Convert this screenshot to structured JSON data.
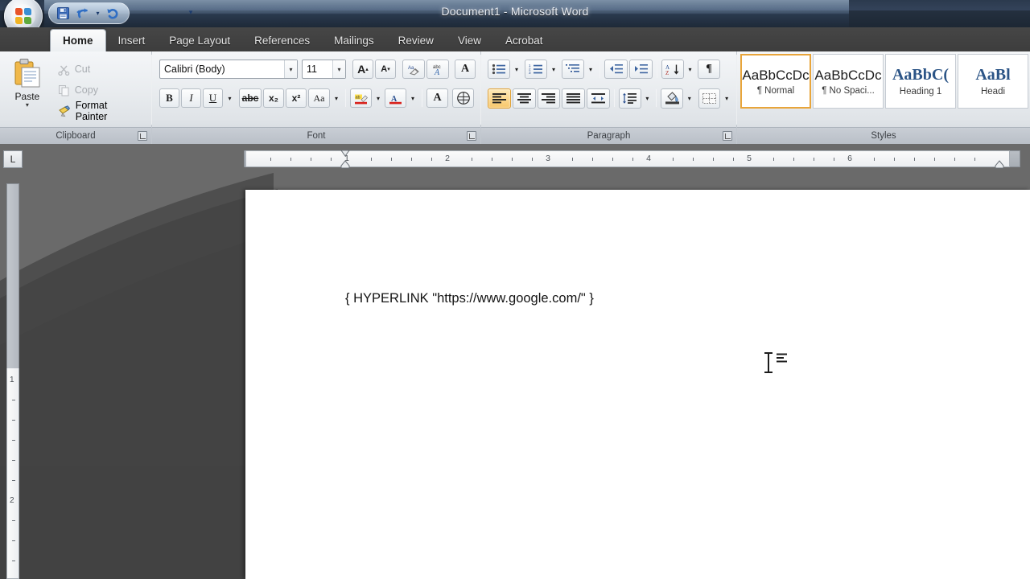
{
  "window": {
    "title": "Document1 - Microsoft Word",
    "office_button": "office-orb"
  },
  "quick_access": {
    "items": [
      {
        "name": "save",
        "label": "Save",
        "icon": "floppy-disk-icon"
      },
      {
        "name": "undo",
        "label": "Undo",
        "icon": "undo-arrow-icon"
      },
      {
        "name": "undo-dropdown",
        "label": "",
        "icon": "chevron-down-icon"
      },
      {
        "name": "redo",
        "label": "Redo",
        "icon": "redo-arrow-icon"
      }
    ],
    "customize_label": "Customize Quick Access Toolbar"
  },
  "ribbon": {
    "tabs": [
      {
        "label": "Home",
        "active": true
      },
      {
        "label": "Insert",
        "active": false
      },
      {
        "label": "Page Layout",
        "active": false
      },
      {
        "label": "References",
        "active": false
      },
      {
        "label": "Mailings",
        "active": false
      },
      {
        "label": "Review",
        "active": false
      },
      {
        "label": "View",
        "active": false
      },
      {
        "label": "Acrobat",
        "active": false
      }
    ],
    "groups": {
      "clipboard": {
        "label": "Clipboard",
        "paste": {
          "label": "Paste",
          "arrow": "▾"
        },
        "items": [
          {
            "label": "Cut",
            "icon": "scissors-icon",
            "enabled": false
          },
          {
            "label": "Copy",
            "icon": "copy-icon",
            "enabled": false
          },
          {
            "label": "Format Painter",
            "icon": "paintbrush-icon",
            "enabled": true
          }
        ]
      },
      "font": {
        "label": "Font",
        "font_name": "Calibri (Body)",
        "font_size": "11",
        "row1": [
          {
            "name": "grow-font",
            "glyph": "A",
            "sup": "▴"
          },
          {
            "name": "shrink-font",
            "glyph": "A",
            "sup": "▾"
          },
          {
            "name": "clear-formatting",
            "glyph": "Aa"
          },
          {
            "name": "change-case",
            "glyph": "abc"
          },
          {
            "name": "text-effects",
            "glyph": "A"
          }
        ],
        "row2": [
          {
            "name": "bold",
            "glyph": "B"
          },
          {
            "name": "italic",
            "glyph": "I"
          },
          {
            "name": "underline",
            "glyph": "U",
            "dropdown": "▾"
          },
          {
            "name": "strikethrough",
            "glyph": "abc"
          },
          {
            "name": "subscript",
            "glyph": "x₂"
          },
          {
            "name": "superscript",
            "glyph": "x²"
          },
          {
            "name": "change-case-2",
            "glyph": "Aa",
            "dropdown": "▾"
          },
          {
            "name": "text-highlight-color",
            "glyph": "ab",
            "dropdown": "▾"
          },
          {
            "name": "font-color",
            "glyph": "A",
            "dropdown": "▾"
          },
          {
            "name": "text-effect",
            "glyph": "A"
          },
          {
            "name": "character-shading",
            "glyph": "Ⓐ"
          }
        ]
      },
      "paragraph": {
        "label": "Paragraph",
        "row1": [
          {
            "name": "bullets",
            "dropdown": "▾"
          },
          {
            "name": "numbering",
            "dropdown": "▾"
          },
          {
            "name": "multilevel-list",
            "dropdown": "▾"
          },
          {
            "name": "decrease-indent"
          },
          {
            "name": "increase-indent"
          },
          {
            "name": "sort",
            "dropdown": "▾"
          },
          {
            "name": "show-hide-marks",
            "glyph": "¶"
          }
        ],
        "row2": [
          {
            "name": "align-left",
            "selected": true
          },
          {
            "name": "align-center",
            "selected": false
          },
          {
            "name": "align-right",
            "selected": false
          },
          {
            "name": "justify",
            "selected": false
          },
          {
            "name": "distributed",
            "selected": false
          },
          {
            "name": "line-spacing",
            "dropdown": "▾"
          },
          {
            "name": "shading",
            "dropdown": "▾"
          },
          {
            "name": "borders",
            "dropdown": "▾"
          }
        ]
      },
      "styles": {
        "label": "Styles",
        "cards": [
          {
            "preview": "AaBbCcDc",
            "name": "¶ Normal",
            "heading": false,
            "selected": true
          },
          {
            "preview": "AaBbCcDc",
            "name": "¶ No Spaci...",
            "heading": false,
            "selected": false
          },
          {
            "preview": "AaBbC(",
            "name": "Heading 1",
            "heading": true,
            "selected": false
          },
          {
            "preview": "AaBl",
            "name": "Headi",
            "heading": true,
            "selected": false
          }
        ]
      }
    }
  },
  "rulers": {
    "tab_selector": "L",
    "horizontal_numbers": [
      "1",
      "2",
      "3",
      "4",
      "5",
      "6"
    ],
    "vertical_numbers": [
      "1",
      "2"
    ]
  },
  "document": {
    "field_code": "{ HYPERLINK \"https://www.google.com/\" }",
    "cursor": "i-beam-text-cursor"
  },
  "colors": {
    "accent_orange": "#e8a53b",
    "title_blue": "#2b3a4d",
    "ribbon_bg": "#eaedf0",
    "desktop_grey": "#4a4a4a",
    "highlight_yellow": "#ffdd22",
    "font_color_red": "#d4201b"
  }
}
